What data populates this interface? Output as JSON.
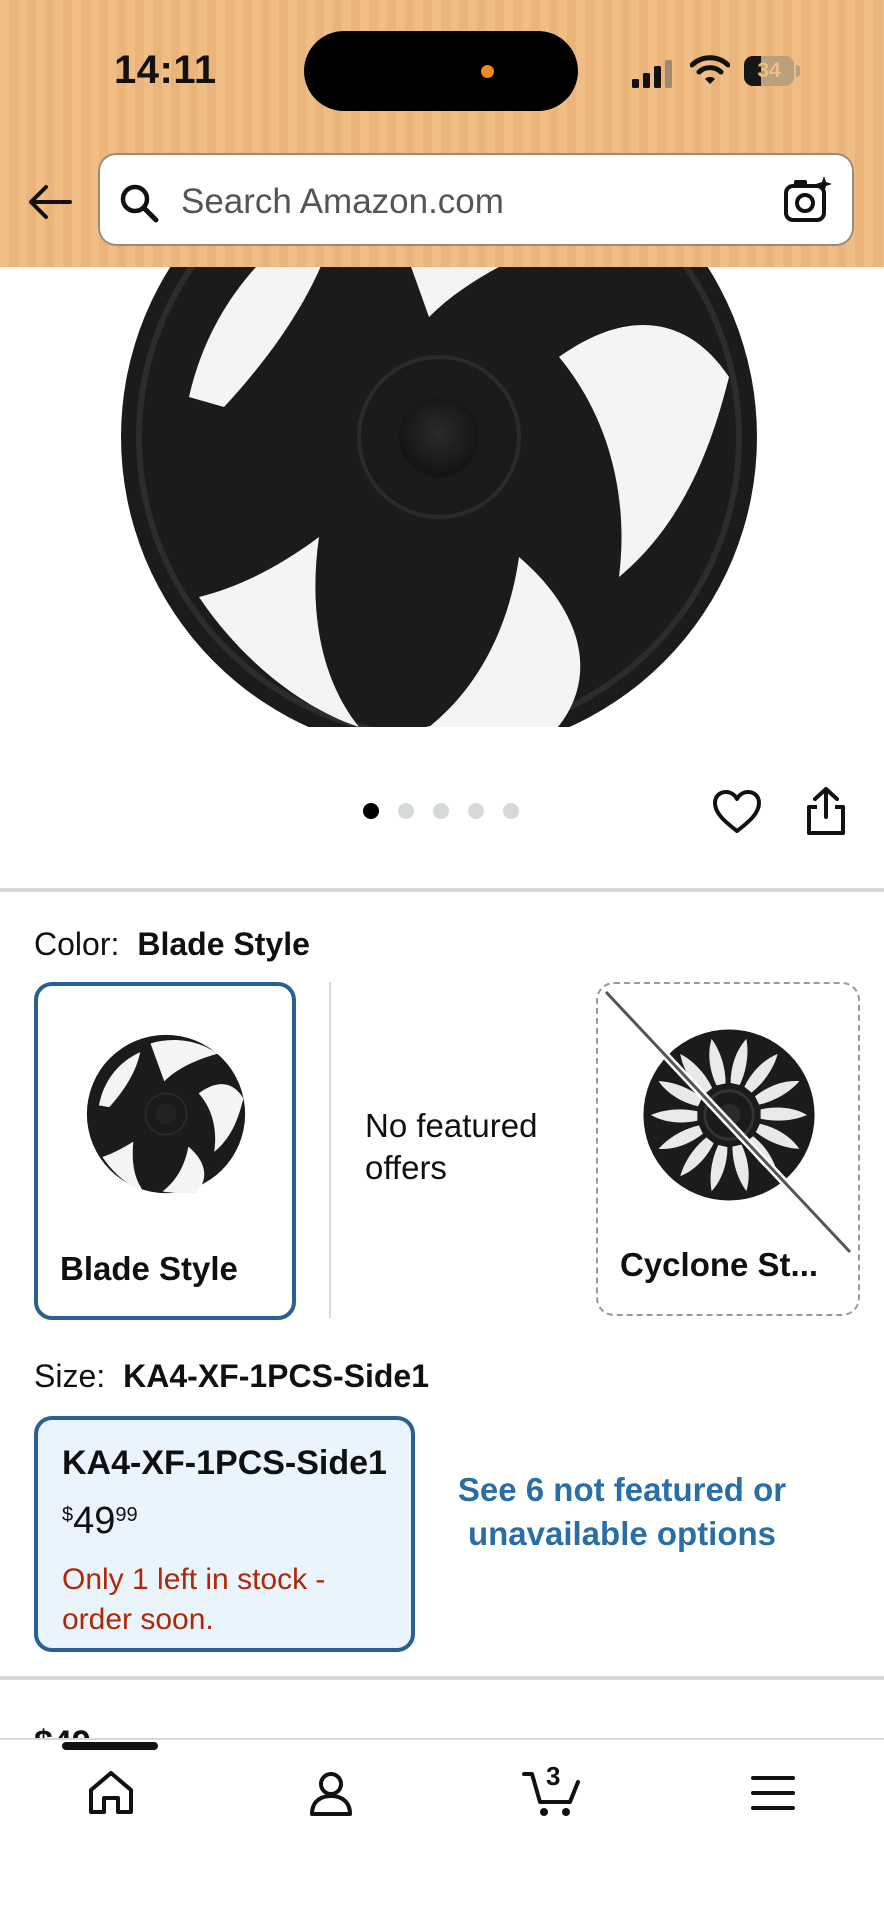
{
  "status_bar": {
    "time": "14:11",
    "battery_level": "34"
  },
  "search": {
    "placeholder": "Search Amazon.com"
  },
  "gallery": {
    "image_count": 5,
    "active_index": 0
  },
  "color_selector": {
    "label": "Color:",
    "selected_value": "Blade Style",
    "options": [
      {
        "name": "Blade Style",
        "state": "selected"
      },
      {
        "name": "No featured offers",
        "state": "info"
      },
      {
        "name": "Cyclone St...",
        "state": "unavailable"
      }
    ]
  },
  "size_selector": {
    "label": "Size:",
    "selected_value": "KA4-XF-1PCS-Side1",
    "selected_option": {
      "name": "KA4-XF-1PCS-Side1",
      "price_symbol": "$",
      "price_whole": "49",
      "price_fraction": "99",
      "stock_message": "Only 1 left in stock - order soon."
    },
    "more_options_link": "See 6 not featured or unavailable options"
  },
  "bottom_nav": {
    "cart_count": "3",
    "items": [
      "home-icon",
      "account-icon",
      "cart-icon",
      "menu-icon"
    ]
  },
  "colors": {
    "header_bg": "#f0bd84",
    "selected_border": "#2a5f92",
    "stock_warning": "#b12704",
    "link": "#2a6ea6"
  }
}
